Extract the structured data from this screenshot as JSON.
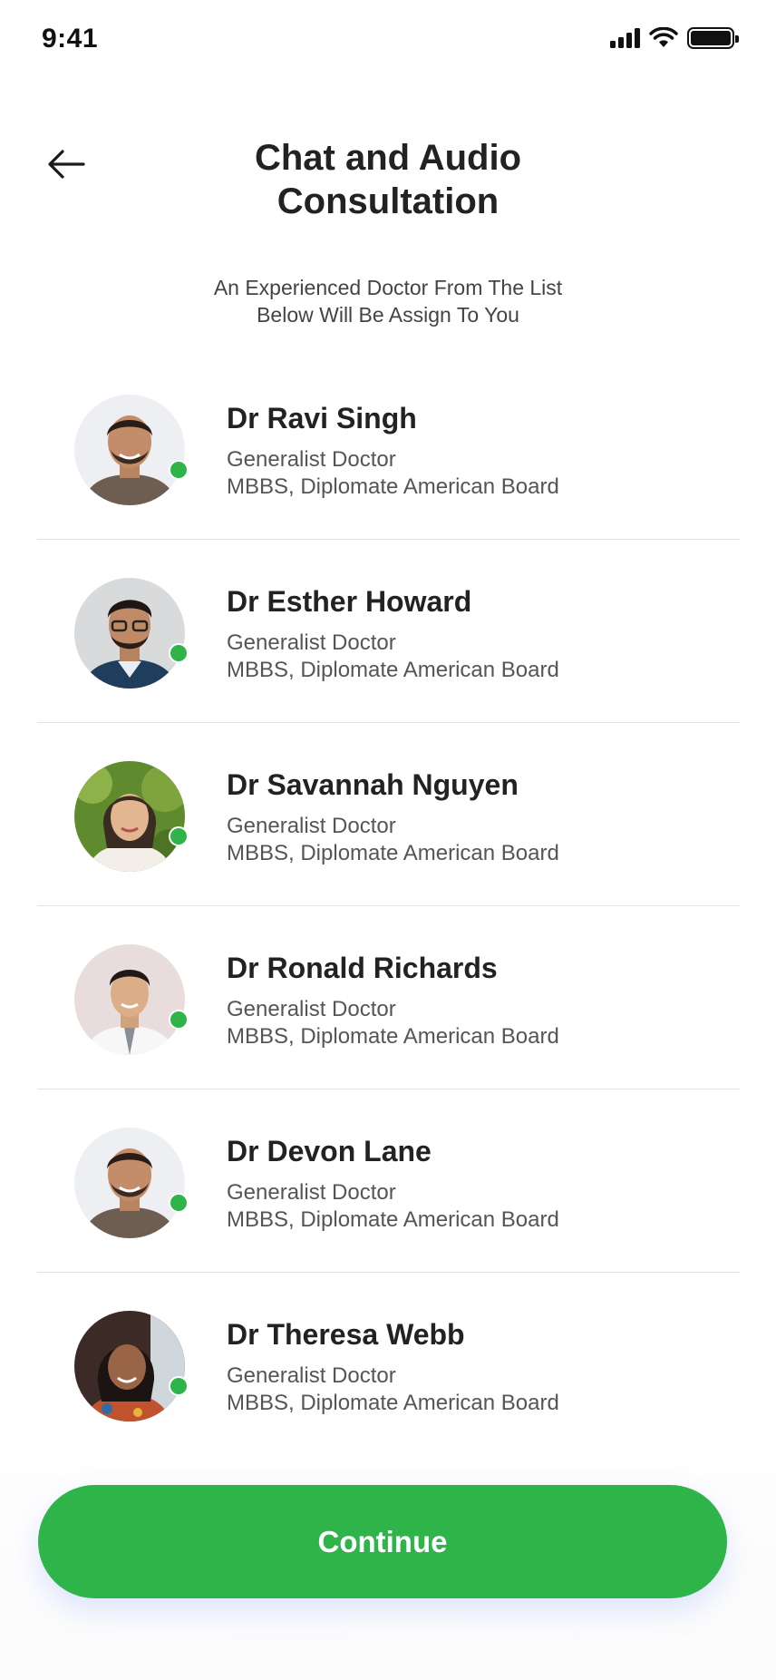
{
  "status_bar": {
    "time": "9:41"
  },
  "header": {
    "title_line1": "Chat and Audio",
    "title_line2": "Consultation"
  },
  "subtitle": {
    "line1": "An Experienced Doctor From The List",
    "line2": "Below Will Be Assign To You"
  },
  "doctors": [
    {
      "name": "Dr Ravi Singh",
      "specialty": "Generalist Doctor",
      "degree": "MBBS, Diplomate American Board"
    },
    {
      "name": "Dr Esther Howard",
      "specialty": "Generalist Doctor",
      "degree": "MBBS, Diplomate American Board"
    },
    {
      "name": "Dr Savannah Nguyen",
      "specialty": "Generalist Doctor",
      "degree": "MBBS, Diplomate American Board"
    },
    {
      "name": "Dr Ronald Richards",
      "specialty": "Generalist Doctor",
      "degree": "MBBS, Diplomate American Board"
    },
    {
      "name": "Dr Devon Lane",
      "specialty": "Generalist Doctor",
      "degree": "MBBS, Diplomate American Board"
    },
    {
      "name": "Dr Theresa Webb",
      "specialty": "Generalist Doctor",
      "degree": "MBBS, Diplomate American Board"
    }
  ],
  "continue_button": {
    "label": "Continue"
  },
  "colors": {
    "accent": "#2fb44a",
    "online_indicator": "#2fb44a",
    "divider": "#e3e3e3",
    "title": "#222222"
  },
  "icons": [
    "back-arrow-icon",
    "cellular-signal-icon",
    "wifi-icon",
    "battery-icon"
  ]
}
